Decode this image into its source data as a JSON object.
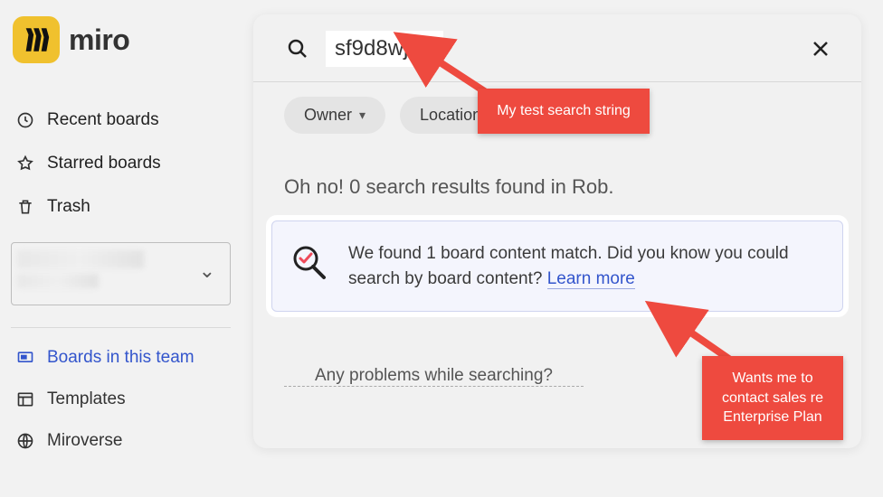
{
  "brand": {
    "name": "miro"
  },
  "sidebar": {
    "nav": {
      "recent": "Recent boards",
      "starred": "Starred boards",
      "trash": "Trash"
    },
    "links": {
      "boards_in_team": "Boards in this team",
      "templates": "Templates",
      "miroverse": "Miroverse"
    }
  },
  "search": {
    "query": "sf9d8wj",
    "filters": {
      "owner": "Owner",
      "location": "Location"
    },
    "no_results_text": "Oh no! 0 search results found in Rob.",
    "info_text_pre": "We found 1 board content match. Did you know you could search by board content? ",
    "learn_more": "Learn more",
    "problems": "Any problems while searching?"
  },
  "annotations": {
    "a1": "My test search string",
    "a2": "Wants me to contact sales re Enterprise Plan"
  }
}
